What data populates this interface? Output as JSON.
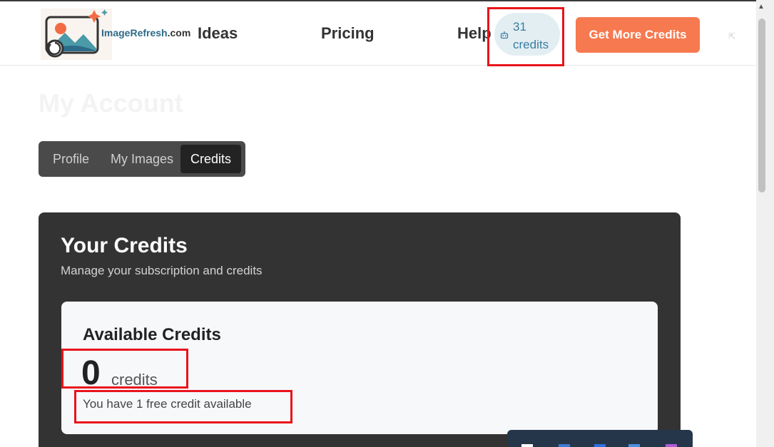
{
  "nav": {
    "logo_name": "ImageRefresh",
    "logo_domain": ".com",
    "links": [
      "Ideas",
      "Pricing",
      "Help"
    ],
    "credits_pill": "31 credits",
    "cta_button": "Get More Credits"
  },
  "page": {
    "title": "My Account",
    "tabs": [
      "Profile",
      "My Images",
      "Credits"
    ],
    "active_tab": "Credits"
  },
  "credits_card": {
    "title": "Your Credits",
    "subtitle": "Manage your subscription and credits",
    "available_label": "Available Credits",
    "available_count": "0",
    "unit": "credits",
    "free_note": "You have 1 free credit available"
  },
  "colors": {
    "accent": "#f7794f",
    "card_bg": "#333333",
    "pill_bg": "#e3eef3",
    "pill_text": "#3a7ea0",
    "highlight": "#e8141b"
  }
}
